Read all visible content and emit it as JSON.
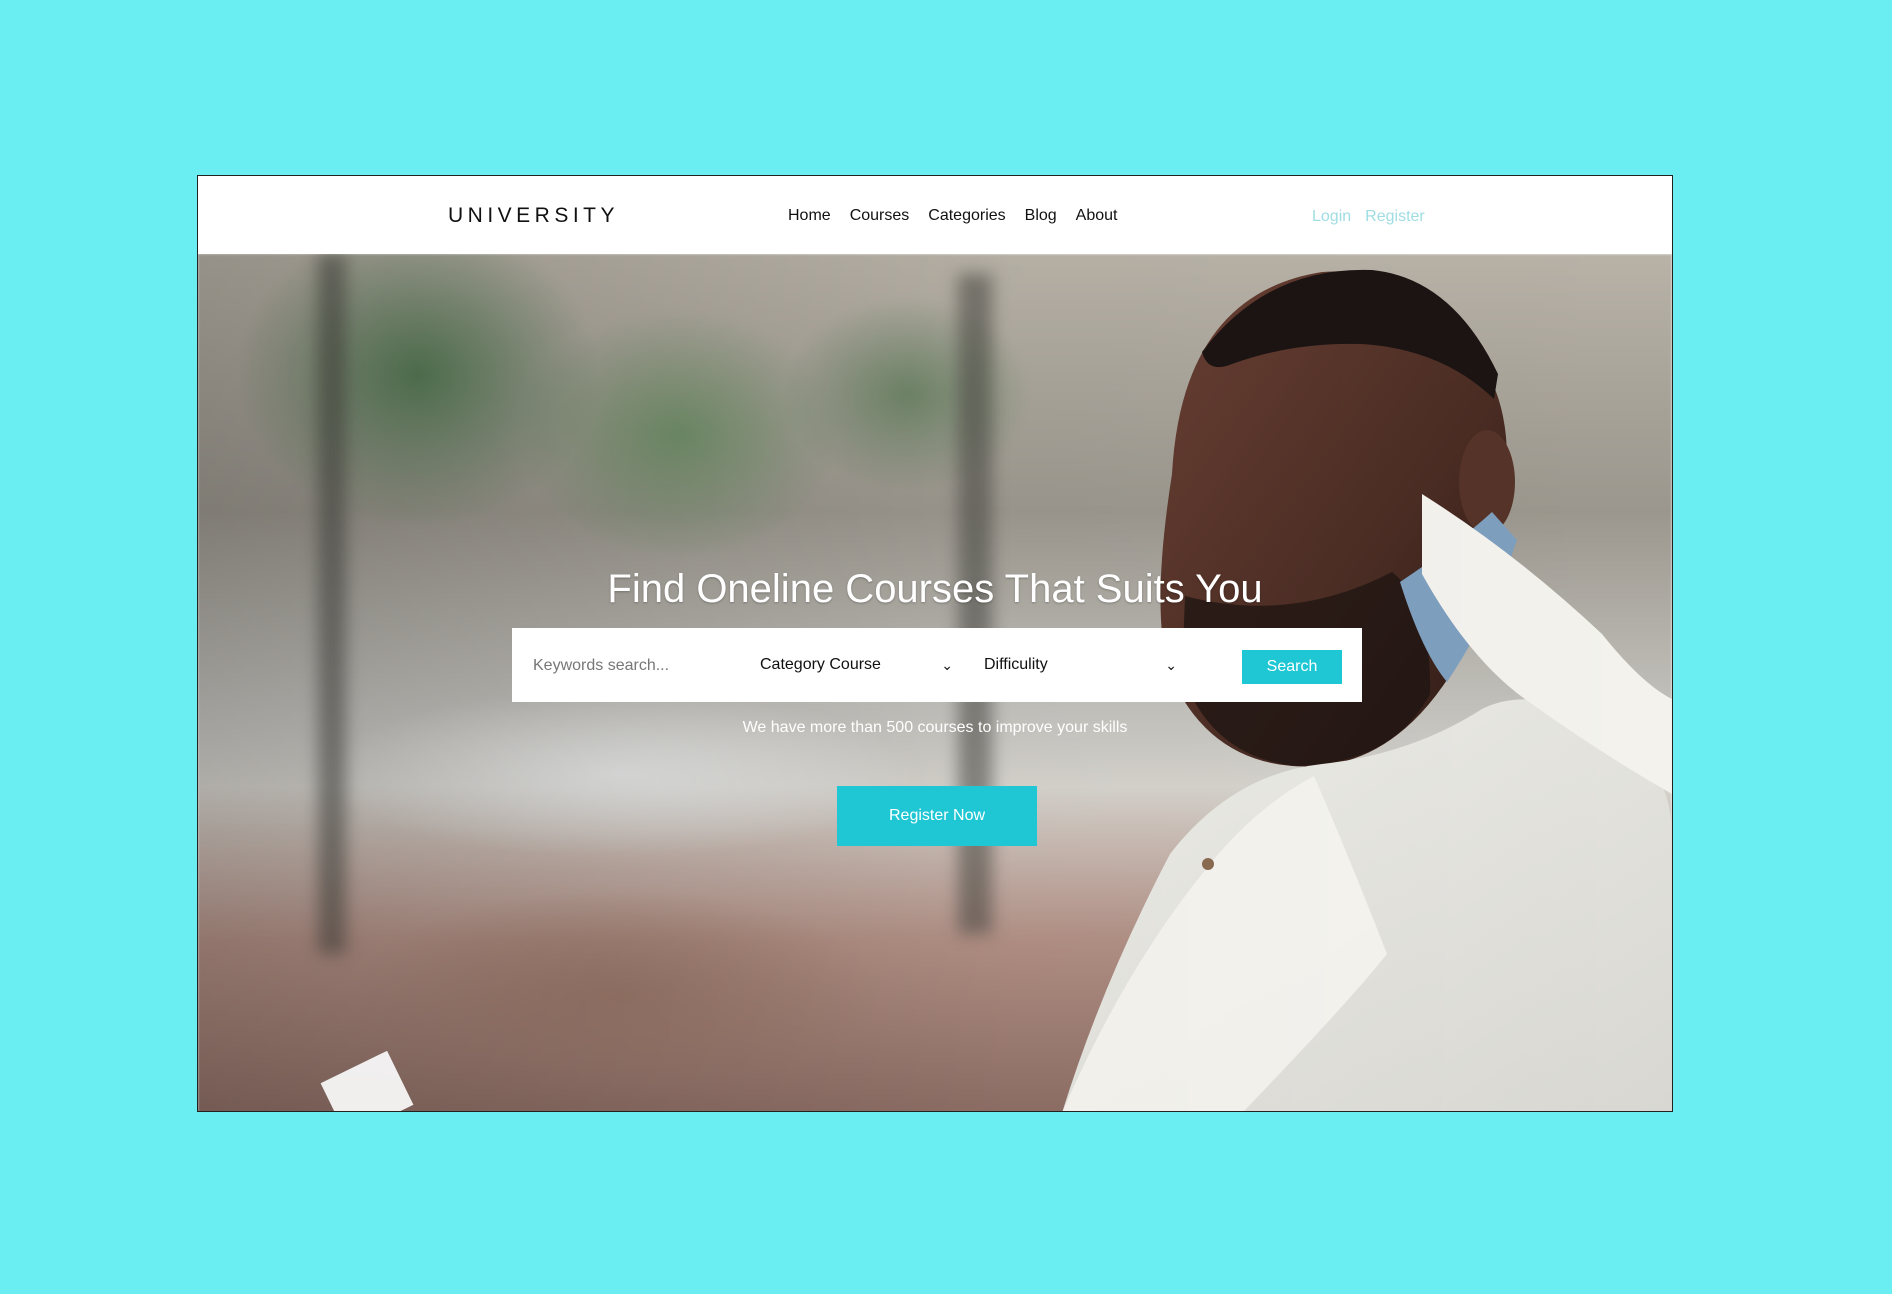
{
  "header": {
    "logo": "UNIVERSITY",
    "nav": [
      "Home",
      "Courses",
      "Categories",
      "Blog",
      "About"
    ],
    "auth": [
      "Login",
      "Register"
    ]
  },
  "hero": {
    "headline": "Find Oneline Courses That Suits You",
    "search": {
      "keywords_placeholder": "Keywords search...",
      "category_selected": "Category Course",
      "difficulty_selected": "Difficulity",
      "button_label": "Search"
    },
    "subtext": "We have more than 500 courses to improve your skills",
    "cta_label": "Register Now"
  },
  "colors": {
    "background": "#6beef2",
    "accent": "#1fc7d4",
    "auth_link": "#9fdde3"
  },
  "icons": {
    "dropdown": "chevron-down-icon"
  }
}
